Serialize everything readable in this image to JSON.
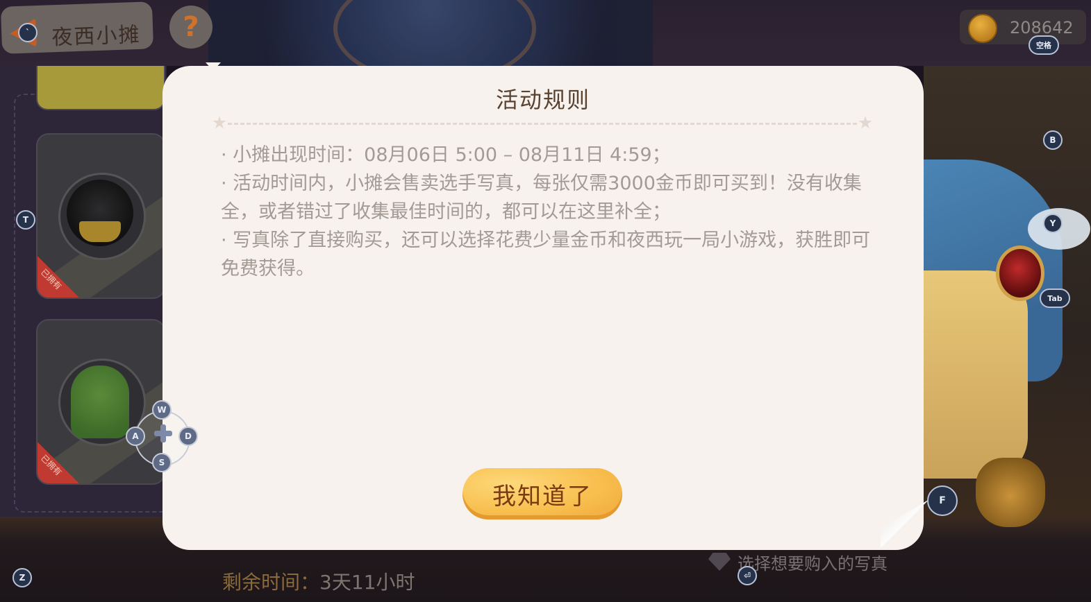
{
  "header": {
    "title": "夜西小摊",
    "back_icon": "back-arrow-icon",
    "help_label": "?"
  },
  "currency": {
    "icon": "coin-icon",
    "amount": "208642"
  },
  "cards": [
    {
      "owned_label": "已拥有"
    },
    {
      "owned_label": "已拥有"
    },
    {
      "owned_label": "已拥有"
    }
  ],
  "bottom": {
    "remaining_label": "剩余时间：",
    "remaining_value": "3天11小时",
    "select_hint": "选择想要购入的写真"
  },
  "modal": {
    "title": "活动规则",
    "rules": [
      "· 小摊出现时间：08月06日 5:00 – 08月11日 4:59；",
      "· 活动时间内，小摊会售卖选手写真，每张仅需3000金币即可买到！没有收集全，或者错过了收集最佳时间的，都可以在这里补全；",
      "· 写真除了直接购买，还可以选择花费少量金币和夜西玩一局小游戏，获胜即可免费获得。"
    ],
    "confirm_label": "我知道了"
  },
  "key_hints": {
    "back": "`",
    "space": "空格",
    "b": "B",
    "t": "T",
    "y": "Y",
    "tab": "Tab",
    "w": "W",
    "a": "A",
    "s": "S",
    "d": "D",
    "f": "F",
    "z": "Z",
    "enter": "⏎"
  },
  "colors": {
    "modal_bg": "#f7f2ee",
    "title": "#5a4230",
    "rule_text": "#a39a94",
    "button": "#f8bf4f",
    "button_text": "#7a3a12"
  }
}
